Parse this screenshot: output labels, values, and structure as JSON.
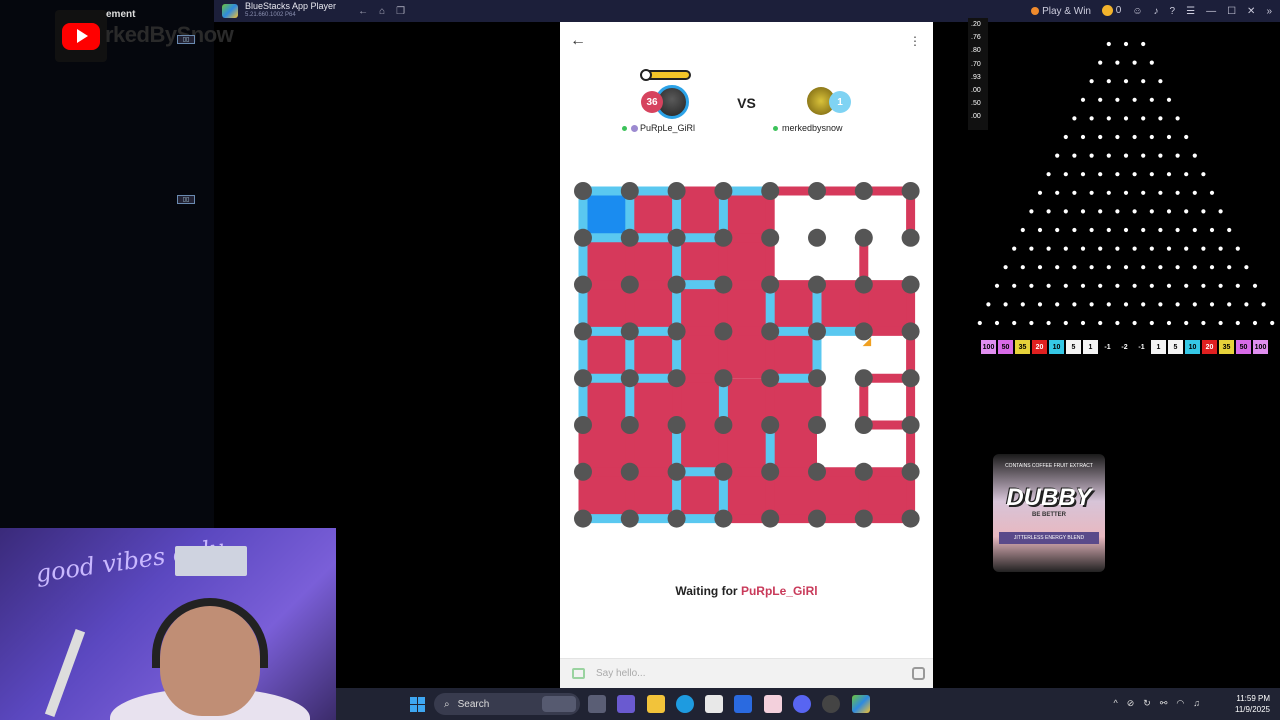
{
  "overlay": {
    "label": "ement",
    "watermark": "rkedBySnow",
    "tag": "▯▯"
  },
  "webcam": {
    "neon_text": "good vibes only"
  },
  "window": {
    "title": "BlueStacks App Player",
    "version": "5.21.660.1002 P64",
    "play_win": "Play & Win",
    "coins": "0"
  },
  "game": {
    "player1": {
      "name": "PuRpLe_GiRl",
      "score": "36"
    },
    "player2": {
      "name": "merkedbysnow",
      "score": "1"
    },
    "vs": "VS",
    "waiting_prefix": "Waiting for",
    "waiting_name": "PuRpLe_GiRl",
    "chat_placeholder": "Say hello...",
    "colors": {
      "player1": "#d6395b",
      "player2": "#5ac8f0",
      "dot": "#555555",
      "selected": "#1a8cf0"
    },
    "board": {
      "rows": 7,
      "cols": 7,
      "h_edges": [
        [
          "b",
          "b",
          "r",
          "b",
          "r",
          "r",
          "r"
        ],
        [
          "b",
          "b",
          "b",
          "r",
          "n",
          "n",
          "n"
        ],
        [
          "r",
          "r",
          "b",
          "r",
          "r",
          "r",
          "r"
        ],
        [
          "b",
          "b",
          "r",
          "r",
          "b",
          "b",
          "r"
        ],
        [
          "b",
          "b",
          "r",
          "n",
          "b",
          "n",
          "r"
        ],
        [
          "r",
          "r",
          "r",
          "r",
          "n",
          "n",
          "r"
        ],
        [
          "r",
          "r",
          "b",
          "r",
          "r",
          "r",
          "r"
        ],
        [
          "b",
          "b",
          "b",
          "r",
          "r",
          "r",
          "r"
        ]
      ],
      "v_edges": [
        [
          "b",
          "b",
          "b",
          "b",
          "r",
          "n",
          "n",
          "r"
        ],
        [
          "b",
          "r",
          "b",
          "r",
          "r",
          "n",
          "r",
          "n"
        ],
        [
          "b",
          "r",
          "b",
          "r",
          "b",
          "b",
          "r",
          "r"
        ],
        [
          "b",
          "b",
          "b",
          "r",
          "r",
          "b",
          "n",
          "r"
        ],
        [
          "b",
          "b",
          "r",
          "b",
          "r",
          "r",
          "r",
          "r"
        ],
        [
          "r",
          "r",
          "b",
          "r",
          "b",
          "n",
          "n",
          "r"
        ],
        [
          "r",
          "r",
          "b",
          "b",
          "r",
          "r",
          "r",
          "r"
        ]
      ],
      "boxes": [
        [
          "s",
          "r",
          "r",
          "r",
          "n",
          "n",
          "n"
        ],
        [
          "r",
          "r",
          "r",
          "r",
          "n",
          "n",
          "n"
        ],
        [
          "r",
          "r",
          "r",
          "r",
          "r",
          "r",
          "r"
        ],
        [
          "r",
          "r",
          "r",
          "r",
          "r",
          "n",
          "n"
        ],
        [
          "r",
          "r",
          "r",
          "r",
          "r",
          "n",
          "n"
        ],
        [
          "r",
          "r",
          "r",
          "r",
          "r",
          "n",
          "n"
        ],
        [
          "r",
          "r",
          "r",
          "r",
          "r",
          "r",
          "r"
        ]
      ]
    }
  },
  "ticker_values": [
    ".20",
    ".76",
    ".80",
    ".70",
    ".93",
    ".00",
    ".50",
    ".00"
  ],
  "plinko": {
    "rows": 16,
    "slots": [
      {
        "label": "100",
        "color": "#e08ef0"
      },
      {
        "label": "50",
        "color": "#d86ae8"
      },
      {
        "label": "35",
        "color": "#e6d23a"
      },
      {
        "label": "20",
        "color": "#e02020"
      },
      {
        "label": "10",
        "color": "#35c8e6"
      },
      {
        "label": "5",
        "color": "#f4f4f4"
      },
      {
        "label": "1",
        "color": "#f4f4f4"
      },
      {
        "label": "-1",
        "color": "#000000"
      },
      {
        "label": "-2",
        "color": "#000000"
      },
      {
        "label": "-1",
        "color": "#000000"
      },
      {
        "label": "1",
        "color": "#f4f4f4"
      },
      {
        "label": "5",
        "color": "#f4f4f4"
      },
      {
        "label": "10",
        "color": "#35c8e6"
      },
      {
        "label": "20",
        "color": "#e02020"
      },
      {
        "label": "35",
        "color": "#e6d23a"
      },
      {
        "label": "50",
        "color": "#d86ae8"
      },
      {
        "label": "100",
        "color": "#e08ef0"
      }
    ]
  },
  "product": {
    "top": "CONTAINS COFFEE FRUIT EXTRACT",
    "name": "DUBBY",
    "sub": "BE BETTER",
    "band": "JITTERLESS ENERGY BLEND"
  },
  "taskbar": {
    "search_label": "Search",
    "time": "11:59 PM",
    "date": "11/9/2025"
  }
}
